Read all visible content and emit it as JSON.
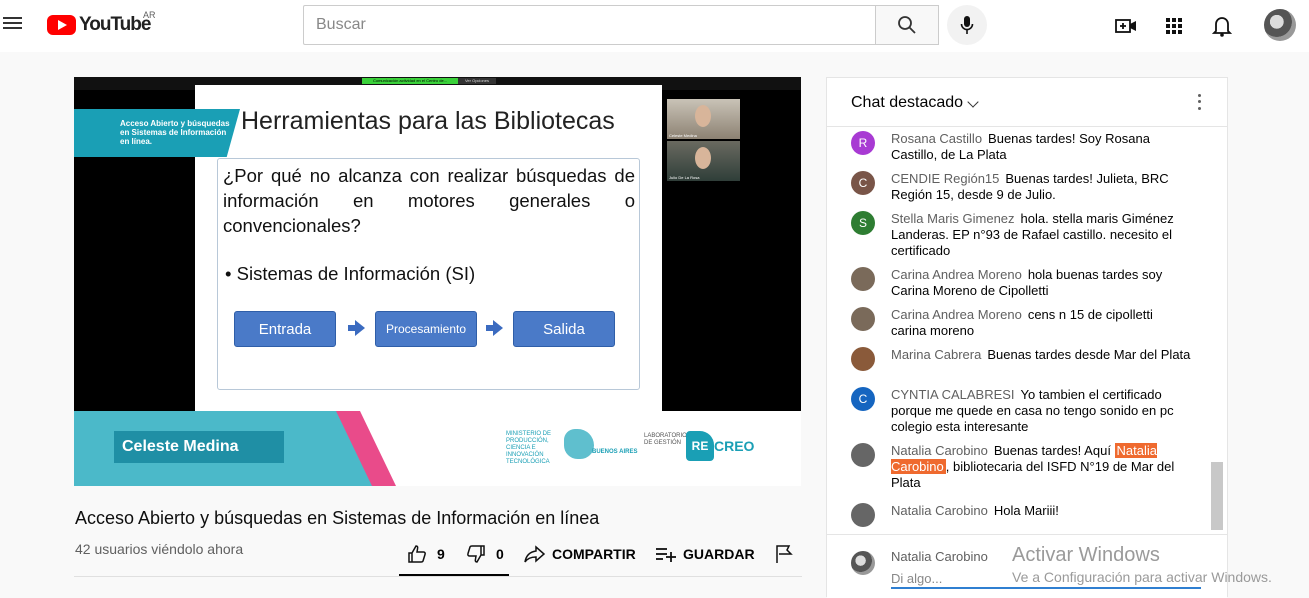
{
  "header": {
    "logo_text": "YouTube",
    "region": "AR",
    "search_placeholder": "Buscar"
  },
  "video": {
    "zoom_top_green": "Comunicación actividad en el Centro de...",
    "zoom_top_dark": "Ver Opciones",
    "slide": {
      "title": "Herramientas para las Bibliotecas",
      "question": "¿Por qué no alcanza con realizar búsquedas de información en motores generales o convencionales?",
      "bullet": "•  Sistemas de Información (SI)",
      "flow": [
        "Entrada",
        "Procesamiento",
        "Salida"
      ],
      "tag": "Acceso Abierto y búsquedas en Sistemas de Información en línea."
    },
    "cams": [
      {
        "caption": "Celeste Medina"
      },
      {
        "caption": "Julio De La Rosa"
      }
    ],
    "lower_third": {
      "name": "Celeste Medina",
      "ministry": "MINISTERIO DE PRODUCCIÓN, CIENCIA E INNOVACIÓN TECNOLÓGICA",
      "province": "BUENOS AIRES",
      "lab": "LABORATORIO DE GESTIÓN",
      "re": "RE",
      "creo": "CREO"
    }
  },
  "meta": {
    "title": "Acceso Abierto y búsquedas en Sistemas de Información en línea",
    "viewers": "42 usuarios viéndolo ahora",
    "like_count": "9",
    "dislike_count": "0",
    "share_label": "COMPARTIR",
    "save_label": "GUARDAR"
  },
  "chat": {
    "title": "Chat destacado",
    "messages": [
      {
        "author": "Rosana Castillo",
        "text": "Buenas tardes! Soy Rosana Castillo, de La Plata",
        "initial": "R",
        "color": "#a83ad3"
      },
      {
        "author": "CENDIE Región15",
        "text": "Buenas tardes! Julieta, BRC Región 15, desde 9 de Julio.",
        "initial": "C",
        "color": "#795548"
      },
      {
        "author": "Stella Maris Gimenez",
        "text": "hola. stella maris Giménez Landeras. EP n°93 de Rafael castillo. necesito el certificado",
        "initial": "S",
        "color": "#2e7d32"
      },
      {
        "author": "Carina Andrea Moreno",
        "text": "hola buenas tardes soy Carina Moreno de Cipolletti",
        "initial": "",
        "color": "#7a6a5a"
      },
      {
        "author": "Carina Andrea Moreno",
        "text": "cens n 15 de cipolletti carina moreno",
        "initial": "",
        "color": "#7a6a5a"
      },
      {
        "author": "Marina Cabrera",
        "text": "Buenas tardes desde Mar del Plata",
        "initial": "",
        "color": "#8a5a3a"
      },
      {
        "author": "CYNTIA CALABRESI",
        "text": "Yo tambien el certificado porque me quede en casa no tengo sonido en pc colegio esta interesante",
        "initial": "C",
        "color": "#1565c0"
      },
      {
        "author": "Natalia Carobino",
        "text_before": "Buenas tardes! Aquí ",
        "highlight": "Natalia Carobino",
        "text_after": ", bibliotecaria del ISFD N°19 de Mar del Plata",
        "initial": "",
        "color": "#666666"
      },
      {
        "author": "Natalia Carobino",
        "text": "Hola Mariii!",
        "initial": "",
        "color": "#666666"
      }
    ],
    "input": {
      "user": "Natalia Carobino",
      "placeholder": "Di algo..."
    }
  },
  "watermark": {
    "line1": "Activar Windows",
    "line2": "Ve a Configuración para activar Windows."
  }
}
